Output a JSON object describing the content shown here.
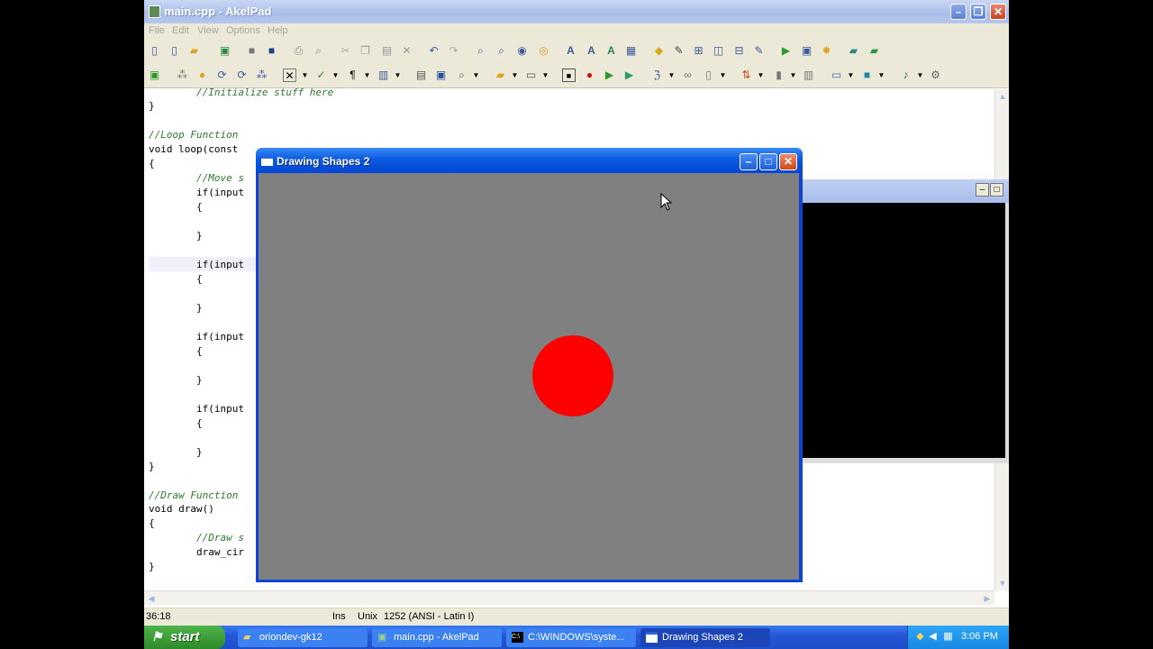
{
  "akelpad": {
    "title": "main.cpp - AkelPad",
    "menu": [
      "File",
      "Edit",
      "View",
      "Options",
      "Help"
    ],
    "code_lines": [
      "        //Initialize stuff here",
      "}",
      "",
      "//Loop Function",
      "void loop(const",
      "{",
      "        //Move s",
      "        if(input",
      "        {",
      "",
      "        }",
      "",
      "        if(input",
      "        {",
      "",
      "        }",
      "",
      "        if(input",
      "        {",
      "",
      "        }",
      "",
      "        if(input",
      "        {",
      "",
      "        }",
      "}",
      "",
      "//Draw Function",
      "void draw()",
      "{",
      "        //Draw s",
      "        draw_cir",
      "}"
    ],
    "status": {
      "position": "36:18",
      "mode": "Ins",
      "line_endings": "Unix",
      "encoding": "1252  (ANSI - Latin I)"
    }
  },
  "drawing_window": {
    "title": "Drawing Shapes 2",
    "background_color": "#808080",
    "shape": {
      "type": "circle",
      "color": "#ff0000"
    }
  },
  "taskbar": {
    "start_label": "start",
    "tasks": [
      {
        "label": "oriondev-gk12",
        "icon": "folder-icon"
      },
      {
        "label": "main.cpp - AkelPad",
        "icon": "notepad-icon"
      },
      {
        "label": "C:\\WINDOWS\\syste...",
        "icon": "console-icon"
      },
      {
        "label": "Drawing Shapes 2",
        "icon": "window-icon"
      }
    ],
    "clock": "3:06 PM"
  }
}
